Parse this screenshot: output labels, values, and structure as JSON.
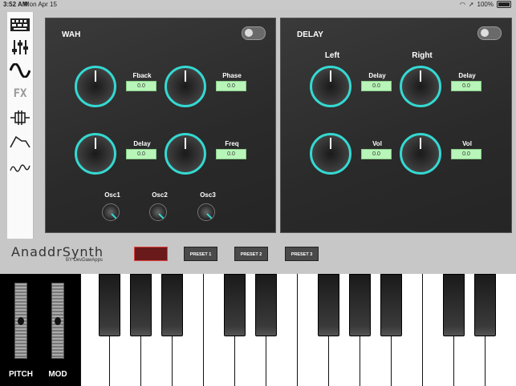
{
  "status": {
    "time": "3:52 AM",
    "date": "Mon Apr 15",
    "battery": "100%"
  },
  "sidebar": {
    "items": [
      {
        "name": "keyboard-icon"
      },
      {
        "name": "mixer-icon"
      },
      {
        "name": "wave-icon"
      },
      {
        "name": "fx-icon",
        "label": "FX"
      },
      {
        "name": "filter-icon"
      },
      {
        "name": "envelope-icon"
      },
      {
        "name": "lfo-icon"
      }
    ]
  },
  "wah": {
    "title": "WAH",
    "knobs": [
      {
        "label": "Fback",
        "value": "0.0"
      },
      {
        "label": "Phase",
        "value": "0.0"
      },
      {
        "label": "Delay",
        "value": "0.0"
      },
      {
        "label": "Freq",
        "value": "0.0"
      }
    ],
    "oscs": [
      "Osc1",
      "Osc2",
      "Osc3"
    ]
  },
  "delay": {
    "title": "DELAY",
    "left_label": "Left",
    "right_label": "Right",
    "knobs": [
      {
        "label": "Delay",
        "value": "0.0"
      },
      {
        "label": "Delay",
        "value": "0.0"
      },
      {
        "label": "Vol",
        "value": "0.0"
      },
      {
        "label": "Vol",
        "value": "0.0"
      }
    ]
  },
  "brand": {
    "name": "AnaddrSynth",
    "sub": "BY DevDawApps"
  },
  "presets": [
    "PRESET 1",
    "PRESET 2",
    "PRESET 3"
  ],
  "controls": {
    "pitch": "PITCH",
    "mod": "MOD"
  },
  "colors": {
    "accent": "#34d9d2",
    "value_bg": "#b8f5b8",
    "record": "#e04040"
  }
}
